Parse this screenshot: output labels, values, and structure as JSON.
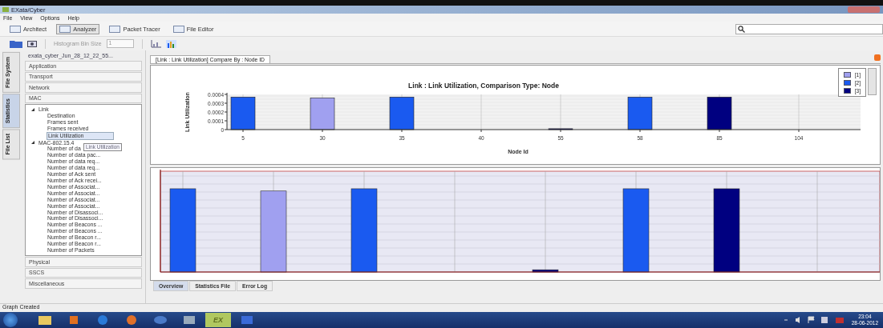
{
  "window": {
    "title": "EXata/Cyber"
  },
  "menu": [
    "File",
    "View",
    "Options",
    "Help"
  ],
  "modes": [
    {
      "label": "Architect",
      "selected": false
    },
    {
      "label": "Analyzer",
      "selected": true
    },
    {
      "label": "Packet Tracer",
      "selected": false
    },
    {
      "label": "File Editor",
      "selected": false
    }
  ],
  "histogram": {
    "label": "Histogram Bin Size",
    "value": "1"
  },
  "side_tabs": [
    {
      "label": "File System",
      "selected": false
    },
    {
      "label": "Statistics",
      "selected": true
    },
    {
      "label": "File List",
      "selected": false
    }
  ],
  "sidebar": {
    "file": "exata_cyber_Jun_28_12_22_55...",
    "groups_top": [
      "Application",
      "Transport",
      "Network",
      "MAC"
    ],
    "tree": [
      {
        "label": "Link",
        "expanded": true,
        "children": [
          {
            "label": "Destination",
            "selected": false
          },
          {
            "label": "Frames sent",
            "selected": false
          },
          {
            "label": "Frames received",
            "selected": false
          },
          {
            "label": "Link Utilization",
            "selected": true
          }
        ]
      },
      {
        "label": "MAC-802.15.4",
        "expanded": true,
        "children": [
          {
            "label": "Number of da",
            "selected": false
          },
          {
            "label": "Number of data pac...",
            "selected": false
          },
          {
            "label": "Number of data req...",
            "selected": false
          },
          {
            "label": "Number of data req...",
            "selected": false
          },
          {
            "label": "Number of Ack sent",
            "selected": false
          },
          {
            "label": "Number of Ack recei...",
            "selected": false
          },
          {
            "label": "Number of Associat...",
            "selected": false
          },
          {
            "label": "Number of Associat...",
            "selected": false
          },
          {
            "label": "Number of Associat...",
            "selected": false
          },
          {
            "label": "Number of Associat...",
            "selected": false
          },
          {
            "label": "Number of Disassoci...",
            "selected": false
          },
          {
            "label": "Number of Disassoci...",
            "selected": false
          },
          {
            "label": "Number of Beacons ...",
            "selected": false
          },
          {
            "label": "Number of Beacons ...",
            "selected": false
          },
          {
            "label": "Number of Beacon r...",
            "selected": false
          },
          {
            "label": "Number of Beacon r...",
            "selected": false
          },
          {
            "label": "Number of Packets",
            "selected": false
          }
        ]
      }
    ],
    "groups_bottom": [
      "Physical",
      "SSCS",
      "Miscellaneous"
    ]
  },
  "tooltip": "Link Utilization",
  "chart_tab": "[Link : Link Utilization] Compare By : Node ID",
  "chart": {
    "chart_data": {
      "type": "bar",
      "title": "Link : Link Utilization, Comparison Type: Node",
      "xlabel": "Node Id",
      "ylabel": "Link Utilization",
      "categories": [
        "5",
        "30",
        "35",
        "40",
        "55",
        "58",
        "85",
        "104"
      ],
      "stacked": true,
      "grid": true,
      "ylim": [
        0,
        0.0004
      ],
      "yticks": [
        0,
        0.0001,
        0.0002,
        0.0003,
        0.0004
      ],
      "series": [
        {
          "name": "[1]",
          "color": "#a0a0f0",
          "values": [
            null,
            0.00036,
            null,
            null,
            null,
            null,
            null,
            null
          ]
        },
        {
          "name": "[2]",
          "color": "#1a5af0",
          "values": [
            0.00037,
            null,
            0.00037,
            null,
            null,
            0.00037,
            null,
            null
          ]
        },
        {
          "name": "[3]",
          "color": "#000080",
          "values": [
            null,
            null,
            null,
            null,
            1e-05,
            null,
            0.00037,
            null
          ]
        }
      ]
    }
  },
  "bottom_tabs": [
    {
      "label": "Overview",
      "selected": true
    },
    {
      "label": "Statistics File",
      "selected": false
    },
    {
      "label": "Error Log",
      "selected": false
    }
  ],
  "status_bar": "Graph Created",
  "taskbar": {
    "apps": [
      {
        "kind": "folder"
      },
      {
        "kind": "media"
      },
      {
        "kind": "browser"
      },
      {
        "kind": "firefox"
      },
      {
        "kind": "dell"
      },
      {
        "kind": "monitor"
      },
      {
        "kind": "exata",
        "label": "EX"
      },
      {
        "kind": "window"
      }
    ],
    "time": "23:04",
    "date": "28-06-2012"
  }
}
